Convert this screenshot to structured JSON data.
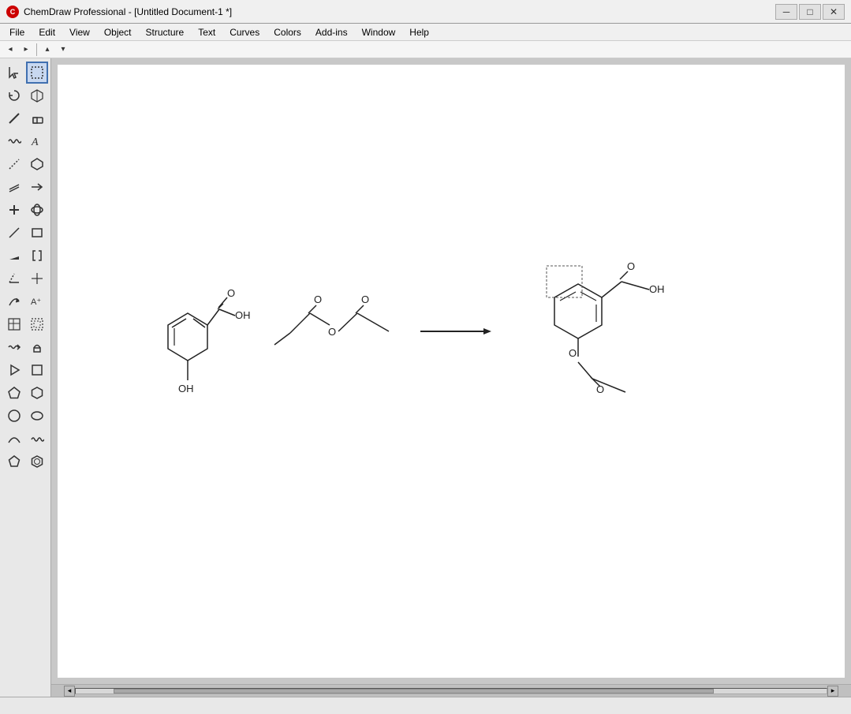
{
  "titleBar": {
    "appName": "ChemDraw Professional",
    "docName": "[Untitled Document-1 *]",
    "minBtn": "─",
    "maxBtn": "□",
    "closeBtn": "✕"
  },
  "menuBar": {
    "items": [
      "File",
      "Edit",
      "View",
      "Object",
      "Structure",
      "Text",
      "Curves",
      "Colors",
      "Add-ins",
      "Window",
      "Help"
    ]
  },
  "toolbar": {
    "items": [
      "◂",
      "▸",
      "─",
      "▴"
    ]
  },
  "tools": [
    {
      "row": 1,
      "tools": [
        {
          "icon": "↖",
          "name": "select"
        },
        {
          "icon": "⬡",
          "name": "lasso",
          "active": true
        }
      ]
    },
    {
      "row": 2,
      "tools": [
        {
          "icon": "◎",
          "name": "rotate"
        },
        {
          "icon": "⬙",
          "name": "transform"
        }
      ]
    },
    {
      "row": 3,
      "tools": [
        {
          "icon": "╱",
          "name": "bond"
        },
        {
          "icon": "⌫",
          "name": "eraser"
        }
      ]
    },
    {
      "row": 4,
      "tools": [
        {
          "icon": "≋",
          "name": "wavy-bond"
        },
        {
          "icon": "A",
          "name": "text"
        }
      ]
    },
    {
      "row": 5,
      "tools": [
        {
          "icon": "⋯",
          "name": "dashed-bond"
        },
        {
          "icon": "⬡",
          "name": "template"
        }
      ]
    },
    {
      "row": 6,
      "tools": [
        {
          "icon": "≈",
          "name": "multi-bond"
        },
        {
          "icon": "→",
          "name": "arrow"
        }
      ]
    },
    {
      "row": 7,
      "tools": [
        {
          "icon": "✦",
          "name": "plus"
        },
        {
          "icon": "❉",
          "name": "orbital"
        }
      ]
    },
    {
      "row": 8,
      "tools": [
        {
          "icon": "╲",
          "name": "line"
        },
        {
          "icon": "▭",
          "name": "rectangle"
        }
      ]
    },
    {
      "row": 9,
      "tools": [
        {
          "icon": "╱",
          "name": "diagonal"
        },
        {
          "icon": "⌐",
          "name": "bracket"
        }
      ]
    },
    {
      "row": 10,
      "tools": [
        {
          "icon": "╱",
          "name": "wedge"
        },
        {
          "icon": "✛",
          "name": "crosshair"
        }
      ]
    },
    {
      "row": 11,
      "tools": [
        {
          "icon": "〰",
          "name": "curved"
        },
        {
          "icon": "A⁺",
          "name": "charge"
        }
      ]
    },
    {
      "row": 12,
      "tools": [
        {
          "icon": "⊞",
          "name": "grid"
        },
        {
          "icon": "⊡",
          "name": "region"
        }
      ]
    },
    {
      "row": 13,
      "tools": [
        {
          "icon": "〜",
          "name": "squiggle"
        },
        {
          "icon": "⬇",
          "name": "stamp"
        }
      ]
    },
    {
      "row": 14,
      "tools": [
        {
          "icon": "▷",
          "name": "play"
        },
        {
          "icon": "▭",
          "name": "box"
        }
      ]
    },
    {
      "row": 15,
      "tools": [
        {
          "icon": "⬡",
          "name": "hexagon"
        },
        {
          "icon": "⬡",
          "name": "cyclohexane"
        }
      ]
    },
    {
      "row": 16,
      "tools": [
        {
          "icon": "○",
          "name": "circle"
        },
        {
          "icon": "○",
          "name": "ellipse"
        }
      ]
    },
    {
      "row": 17,
      "tools": [
        {
          "icon": "⌒",
          "name": "arc"
        },
        {
          "icon": "〜",
          "name": "wave"
        }
      ]
    },
    {
      "row": 18,
      "tools": [
        {
          "icon": "⬠",
          "name": "penta"
        },
        {
          "icon": "⬡",
          "name": "benz"
        }
      ]
    }
  ],
  "canvas": {
    "backgroundColor": "#ffffff"
  }
}
